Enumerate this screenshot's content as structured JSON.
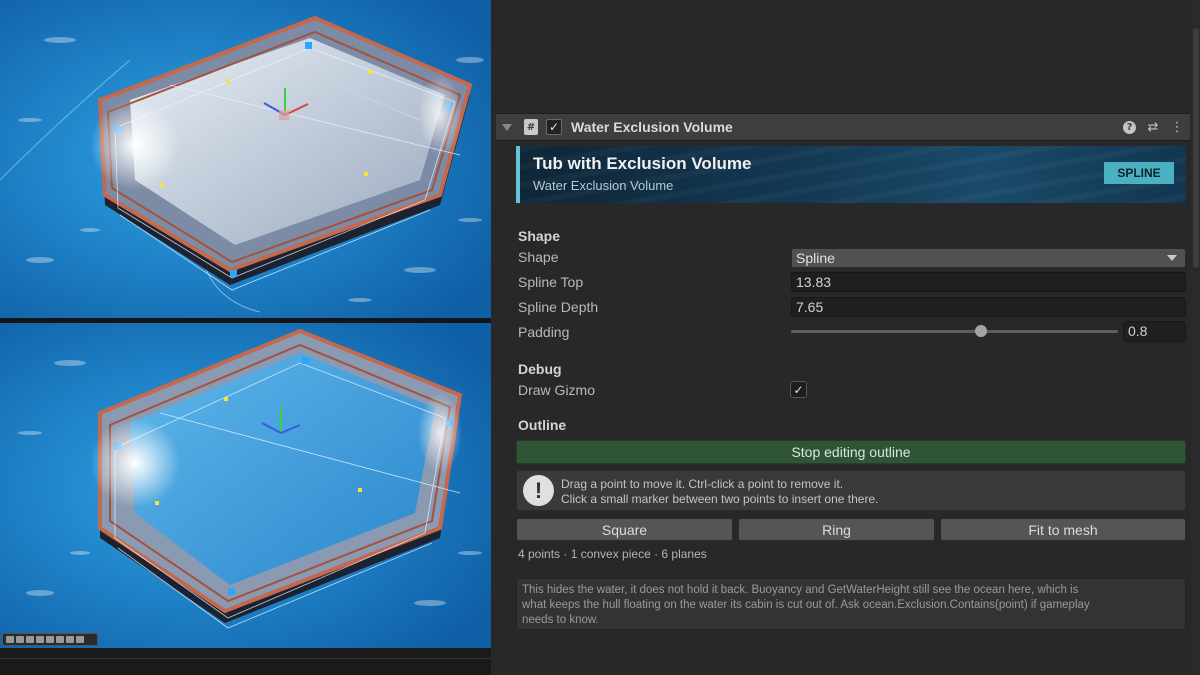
{
  "component": {
    "title": "Water Exclusion Volume",
    "enabled_mark": "✓",
    "header_icons": [
      "help-icon",
      "preset-icon",
      "more-icon"
    ]
  },
  "banner": {
    "title": "Tub with Exclusion Volume",
    "subtitle": "Water Exclusion Volume",
    "badge": "SPLINE"
  },
  "shape_section": {
    "heading": "Shape",
    "shape_label": "Shape",
    "shape_value": "Spline",
    "spline_top_label": "Spline Top",
    "spline_top_value": "13.83",
    "spline_depth_label": "Spline Depth",
    "spline_depth_value": "7.65",
    "padding_label": "Padding",
    "padding_value": "0.8",
    "padding_fraction": 0.58
  },
  "debug_section": {
    "heading": "Debug",
    "draw_gizmo_label": "Draw Gizmo",
    "draw_gizmo_mark": "✓"
  },
  "outline_section": {
    "heading": "Outline",
    "stop_editing_label": "Stop editing outline",
    "help_icon_glyph": "!",
    "help_line_1": "Drag a point to move it. Ctrl-click a point to remove it.",
    "help_line_2": "Click a small marker between two points to insert one there.",
    "buttons": [
      "Square",
      "Ring",
      "Fit to mesh"
    ],
    "stats": "4 points · 1 convex piece · 6 planes"
  },
  "note": {
    "line_1": "This hides the water, it does not hold it back. Buoyancy and GetWaterHeight still see the ocean here, which is",
    "line_2": "what keeps the hull floating on the water its cabin is cut out of. Ask ocean.Exclusion.Contains(point) if gameplay",
    "line_3": "needs to know."
  },
  "colors": {
    "accent": "#62c5d6",
    "badge": "#4bb0bf",
    "green_button": "#2f5536",
    "water": "#1c7bc6",
    "rail": "#c4684e"
  }
}
